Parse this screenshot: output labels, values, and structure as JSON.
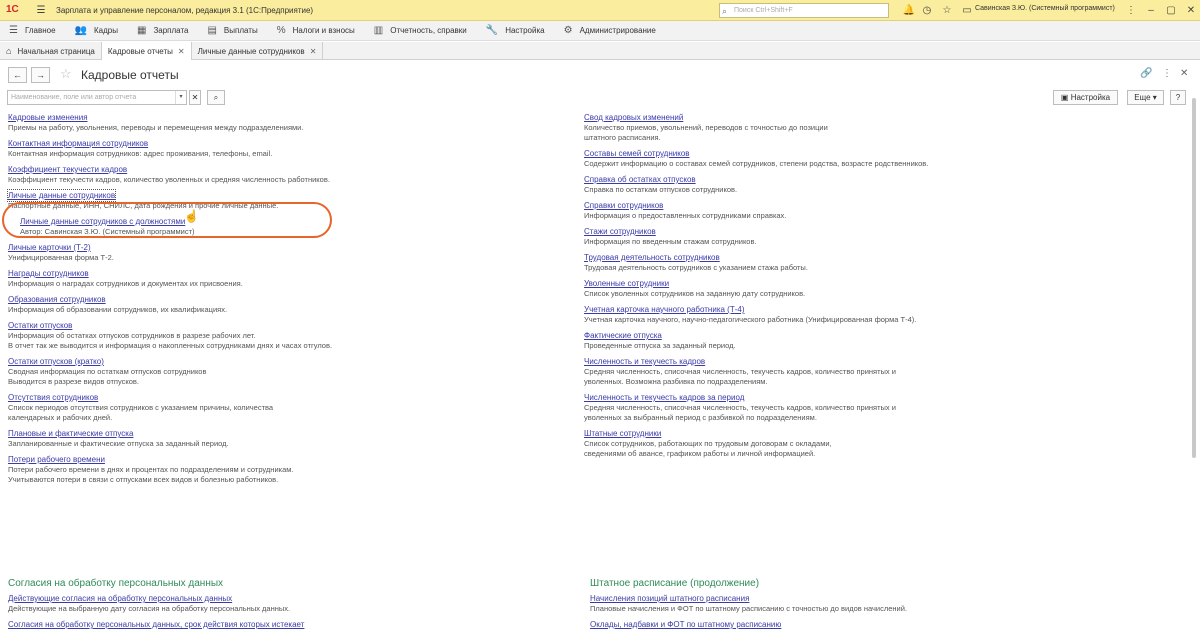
{
  "titlebar": {
    "app_title": "Зарплата и управление персоналом, редакция 3.1  (1С:Предприятие)",
    "search_placeholder": "Поиск Ctrl+Shift+F",
    "user": "Савинская З.Ю. (Системный программист)"
  },
  "menu": [
    {
      "label": "Главное",
      "icon": "menu-icon"
    },
    {
      "label": "Кадры",
      "icon": "people-icon"
    },
    {
      "label": "Зарплата",
      "icon": "calculator-icon"
    },
    {
      "label": "Выплаты",
      "icon": "wallet-icon"
    },
    {
      "label": "Налоги и взносы",
      "icon": "percent-icon"
    },
    {
      "label": "Отчетность, справки",
      "icon": "document-icon"
    },
    {
      "label": "Настройка",
      "icon": "wrench-icon"
    },
    {
      "label": "Администрирование",
      "icon": "gear-icon"
    }
  ],
  "tabs": [
    {
      "label": "Начальная страница"
    },
    {
      "label": "Кадровые отчеты"
    },
    {
      "label": "Личные данные сотрудников"
    }
  ],
  "form": {
    "title": "Кадровые отчеты",
    "filter_placeholder": "Наименование, поле или автор отчета",
    "settings_btn": "Настройка",
    "more_btn": "Еще",
    "help_btn": "?"
  },
  "left_reports": [
    {
      "title": "Кадровые изменения",
      "desc": "Приемы на работу, увольнения, переводы и перемещения между подразделениями."
    },
    {
      "title": "Контактная информация сотрудников",
      "desc": "Контактная информация сотрудников: адрес проживания, телефоны, email."
    },
    {
      "title": "Коэффициент текучести кадров",
      "desc": "Коэффициент текучести кадров, количество уволенных и средняя численность работников."
    },
    {
      "title": "Личные данные сотрудников",
      "desc": "Паспортные данные, ИНН, СНИЛС, дата рождения и прочие личные данные."
    },
    {
      "title": "Личные данные сотрудников с должностями",
      "desc": "Автор: Савинская З.Ю. (Системный программист)"
    },
    {
      "title": "Личные карточки (Т-2)",
      "desc": "Унифицированная форма Т-2."
    },
    {
      "title": "Награды сотрудников",
      "desc": "Информация о наградах сотрудников и документах их присвоения."
    },
    {
      "title": "Образования сотрудников",
      "desc": "Информация об образовании сотрудников, их квалификациях."
    },
    {
      "title": "Остатки отпусков",
      "desc": "Информация об остатках отпусков сотрудников в разрезе рабочих лет.\nВ отчет так же выводится и информация о накопленных сотрудниками днях и часах отгулов."
    },
    {
      "title": "Остатки отпусков (кратко)",
      "desc": "Сводная информация по остаткам отпусков сотрудников\nВыводится в разрезе видов отпусков."
    },
    {
      "title": "Отсутствия сотрудников",
      "desc": "Список периодов отсутствия сотрудников с указанием причины, количества\nкалендарных и рабочих дней."
    },
    {
      "title": "Плановые и фактические отпуска",
      "desc": "Запланированные и фактические отпуска за заданный период."
    },
    {
      "title": "Потери рабочего времени",
      "desc": "Потери рабочего времени в днях и процентах по подразделениям и сотрудникам.\nУчитываются потери в связи с отпусками всех видов и болезнью работников."
    }
  ],
  "right_reports": [
    {
      "title": "Свод кадровых изменений",
      "desc": "Количество приемов, увольнений, переводов с точностью до позиции\nштатного расписания."
    },
    {
      "title": "Составы семей сотрудников",
      "desc": "Содержит информацию о составах семей сотрудников, степени родства, возрасте родственников."
    },
    {
      "title": "Справка об остатках отпусков",
      "desc": "Справка по остаткам отпусков сотрудников."
    },
    {
      "title": "Справки сотрудников",
      "desc": "Информация о предоставленных сотрудниками справках."
    },
    {
      "title": "Стажи сотрудников",
      "desc": "Информация по введенным стажам сотрудников."
    },
    {
      "title": "Трудовая деятельность сотрудников",
      "desc": "Трудовая деятельность сотрудников с указанием стажа работы."
    },
    {
      "title": "Уволенные сотрудники",
      "desc": "Список уволенных сотрудников на заданную дату сотрудников."
    },
    {
      "title": "Учетная карточка научного работника (Т-4)",
      "desc": "Учетная карточка научного, научно-педагогического работника (Унифицированная форма Т-4)."
    },
    {
      "title": "Фактические отпуска",
      "desc": "Проведенные отпуска за заданный период."
    },
    {
      "title": "Численность и текучесть кадров",
      "desc": "Средняя численность, списочная численность, текучесть кадров, количество принятых и\nуволенных. Возможна разбивка по подразделениям."
    },
    {
      "title": "Численность и текучесть кадров за период",
      "desc": "Средняя численность, списочная численность, текучесть кадров, количество принятых и\nуволенных за выбранный период с разбивкой по подразделениям."
    },
    {
      "title": "Штатные сотрудники",
      "desc": "Список сотрудников, работающих по трудовым договорам с окладами,\nсведениями об авансе, графиком работы и личной информацией."
    }
  ],
  "section_left": {
    "heading": "Согласия на обработку персональных данных",
    "items": [
      {
        "title": "Действующие согласия на обработку персональных данных",
        "desc": "Действующие на выбранную дату согласия на обработку персональных данных."
      },
      {
        "title": "Согласия на обработку персональных данных, срок действия которых истекает",
        "desc": ""
      }
    ]
  },
  "section_right": {
    "heading": "Штатное расписание (продолжение)",
    "items": [
      {
        "title": "Начисления позиций штатного расписания",
        "desc": "Плановые начисления и ФОТ по штатному расписанию с точностью до видов начислений."
      },
      {
        "title": "Оклады, надбавки и ФОТ по штатному расписанию",
        "desc": ""
      }
    ]
  }
}
